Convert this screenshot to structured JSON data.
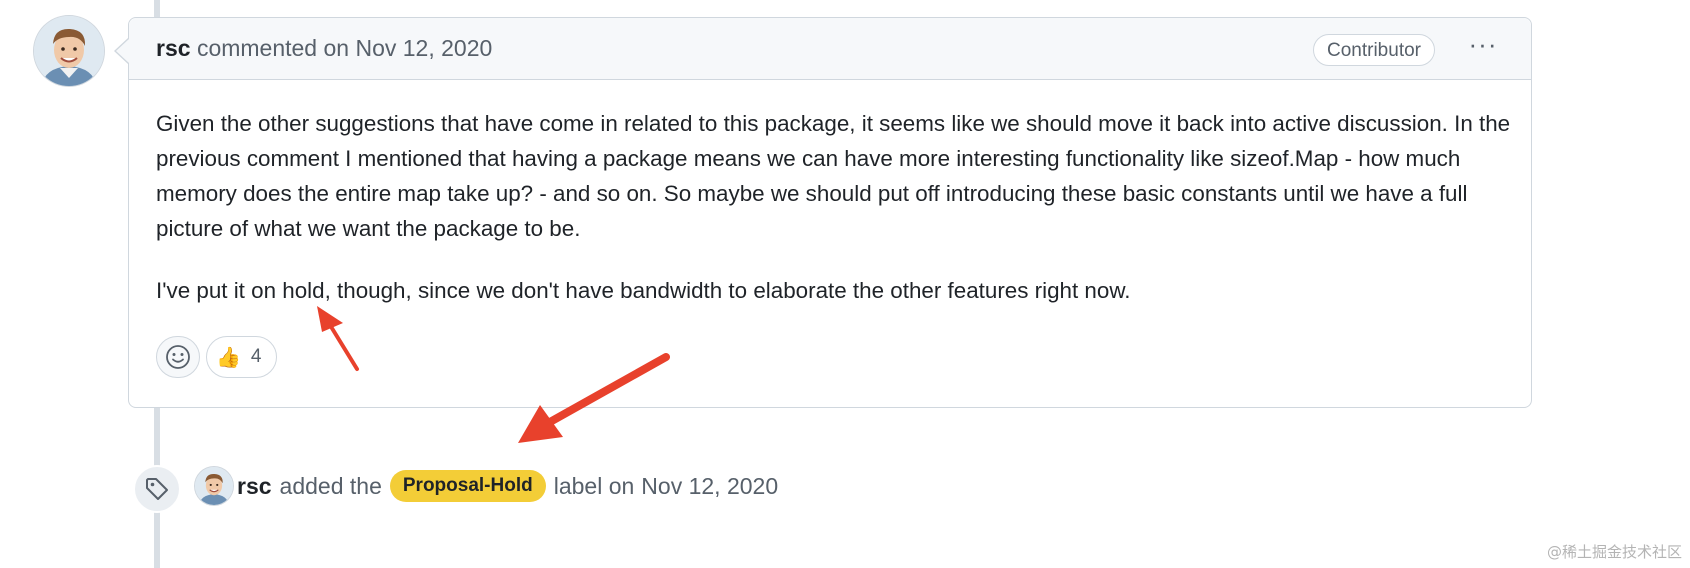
{
  "comment": {
    "author": "rsc",
    "action": "commented on",
    "date": "Nov 12, 2020",
    "badge": "Contributor",
    "menu_glyph": "···",
    "paragraphs": [
      "Given the other suggestions that have come in related to this package, it seems like we should move it back into active discussion. In the previous comment I mentioned that having a package means we can have more interesting functionality like sizeof.Map - how much memory does the entire map take up? - and so on. So maybe we should put off introducing these basic constants until we have a full picture of what we want the package to be.",
      "I've put it on hold, though, since we don't have bandwidth to elaborate the other features right now."
    ],
    "reactions": [
      {
        "emoji": "👍",
        "count": "4"
      }
    ]
  },
  "event": {
    "author": "rsc",
    "action_before": "added the",
    "label": "Proposal-Hold",
    "label_color": "#f3cd37",
    "action_after": "label on",
    "date": "Nov 12, 2020"
  },
  "watermark": "@稀土掘金技术社区",
  "annotation_color": "#e8412c"
}
